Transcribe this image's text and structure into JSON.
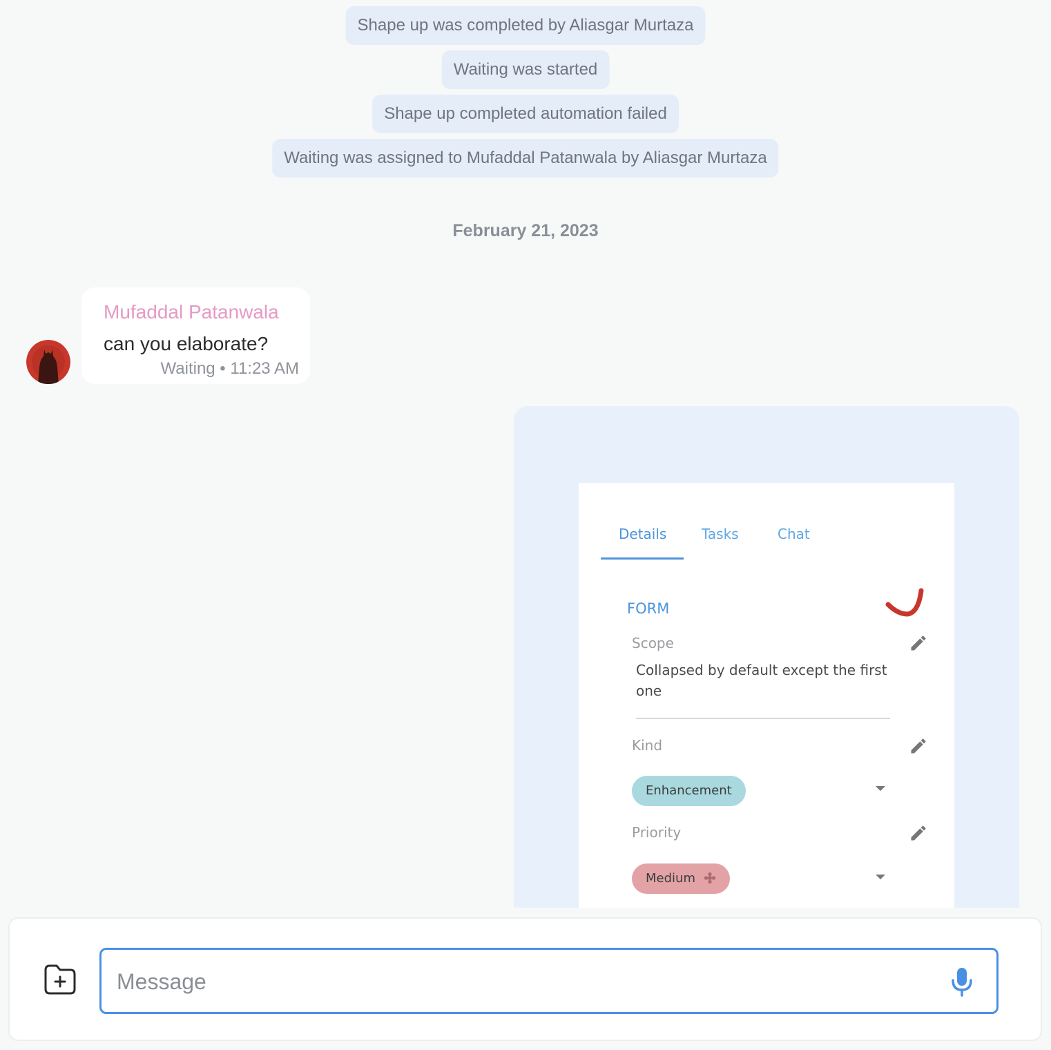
{
  "system_messages": [
    "Shape up was completed by Aliasgar Murtaza",
    "Waiting was started",
    "Shape up completed automation failed",
    "Waiting was assigned to Mufaddal Patanwala by Aliasgar Murtaza"
  ],
  "date_separator": "February 21, 2023",
  "incoming_message": {
    "sender": "Mufaddal Patanwala",
    "text": "can you elaborate?",
    "status": "Waiting",
    "time": "11:23 AM",
    "meta": "Waiting • 11:23 AM"
  },
  "attachment_screenshot": {
    "tabs": [
      "Details",
      "Tasks",
      "Chat"
    ],
    "active_tab": "Details",
    "form_title": "FORM",
    "fields": {
      "scope_label": "Scope",
      "scope_value": "Collapsed by default except the first one",
      "kind_label": "Kind",
      "kind_value": "Enhancement",
      "priority_label": "Priority",
      "priority_value": "Medium"
    }
  },
  "composer": {
    "placeholder": "Message"
  },
  "colors": {
    "accent": "#4a90e2",
    "system_bubble": "#e5edf8",
    "sender_name": "#e59ac4",
    "outgoing_bubble": "#e7f0fb",
    "kind_chip": "#a9d9df",
    "priority_chip": "#e3a3a6"
  },
  "icons": {
    "attach": "folder-plus-icon",
    "mic": "microphone-icon",
    "edit": "pencil-icon",
    "dropdown": "caret-down-icon"
  }
}
